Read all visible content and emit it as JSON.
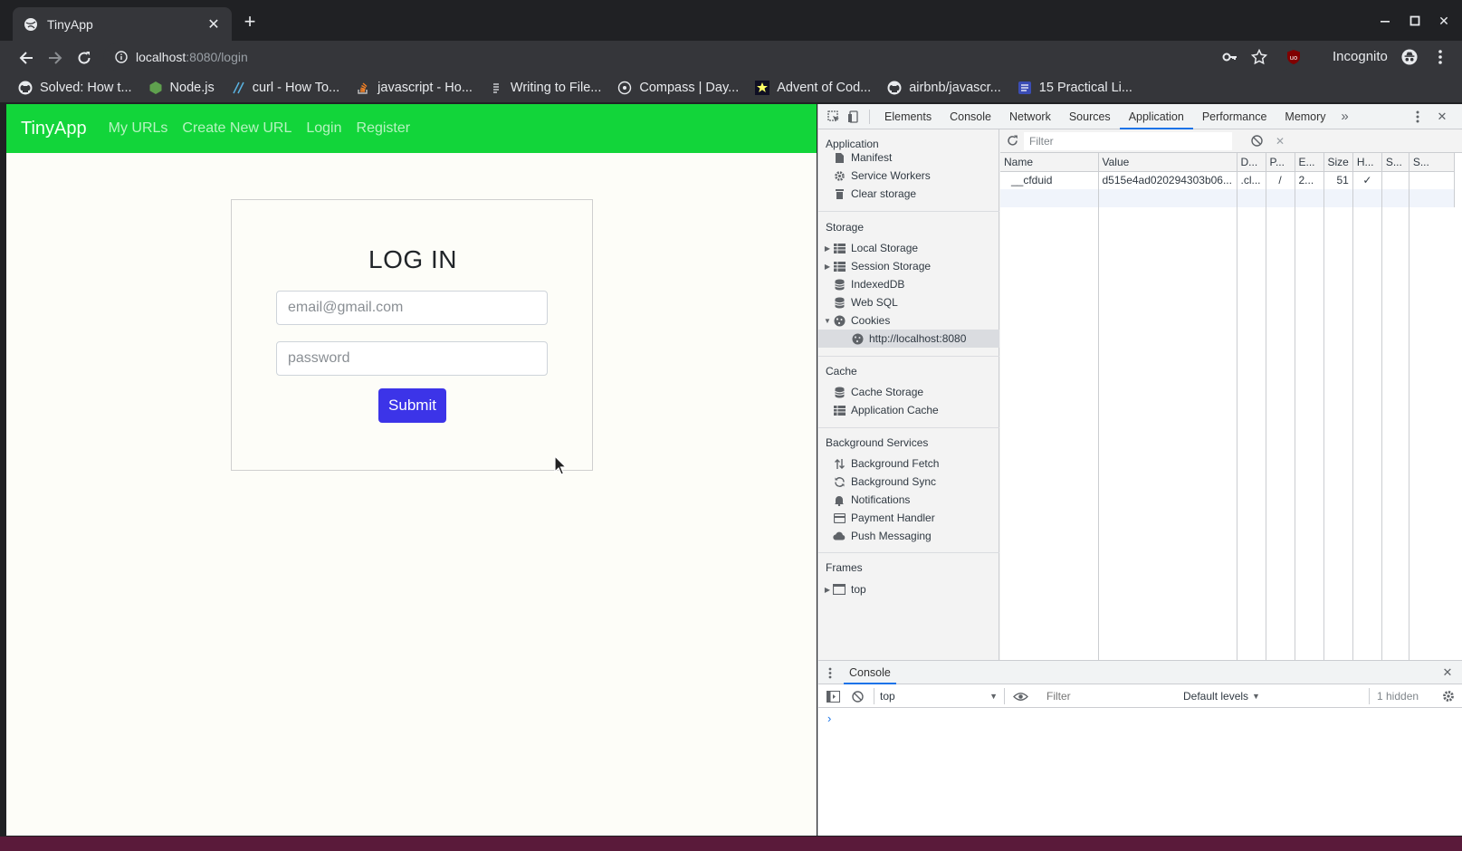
{
  "browser": {
    "tab_title": "TinyApp",
    "url_host": "localhost",
    "url_path": ":8080/login",
    "profile_label": "Incognito",
    "bookmarks": [
      {
        "label": "Solved: How t...",
        "icon": "github-icon"
      },
      {
        "label": "Node.js",
        "icon": "nodejs-icon"
      },
      {
        "label": "curl - How To...",
        "icon": "curl-icon"
      },
      {
        "label": "javascript - Ho...",
        "icon": "stackoverflow-icon"
      },
      {
        "label": "Writing to File...",
        "icon": "page-icon"
      },
      {
        "label": "Compass | Day...",
        "icon": "compass-icon"
      },
      {
        "label": "Advent of Cod...",
        "icon": "star-icon"
      },
      {
        "label": "airbnb/javascr...",
        "icon": "github-icon"
      },
      {
        "label": "15 Practical Li...",
        "icon": "doc-icon"
      }
    ]
  },
  "app": {
    "brand": "TinyApp",
    "nav": {
      "my_urls": "My URLs",
      "create_new_url": "Create New URL",
      "login": "Login",
      "register": "Register"
    },
    "login_form": {
      "heading": "LOG IN",
      "email_placeholder": "email@gmail.com",
      "password_placeholder": "password",
      "submit_label": "Submit"
    }
  },
  "devtools": {
    "tabs": [
      "Elements",
      "Console",
      "Network",
      "Sources",
      "Application",
      "Performance",
      "Memory"
    ],
    "active_tab": "Application",
    "sidebar": {
      "application_header": "Application",
      "application_items": [
        "Manifest",
        "Service Workers",
        "Clear storage"
      ],
      "storage_header": "Storage",
      "storage_items": [
        "Local Storage",
        "Session Storage",
        "IndexedDB",
        "Web SQL",
        "Cookies"
      ],
      "cookie_origin": "http://localhost:8080",
      "cache_header": "Cache",
      "cache_items": [
        "Cache Storage",
        "Application Cache"
      ],
      "bg_header": "Background Services",
      "bg_items": [
        "Background Fetch",
        "Background Sync",
        "Notifications",
        "Payment Handler",
        "Push Messaging"
      ],
      "frames_header": "Frames",
      "frames_items": [
        "top"
      ]
    },
    "cookies": {
      "filter_placeholder": "Filter",
      "columns": [
        "Name",
        "Value",
        "D...",
        "P...",
        "E...",
        "Size",
        "H...",
        "S...",
        "S..."
      ],
      "rows": [
        [
          "__cfduid",
          "d515e4ad020294303b06...",
          ".cl...",
          "/",
          "2...",
          "51",
          "✓",
          "",
          ""
        ]
      ]
    },
    "drawer": {
      "tab": "Console",
      "context": "top",
      "filter_placeholder": "Filter",
      "levels": "Default levels",
      "hidden_count": "1 hidden",
      "prompt": "›"
    }
  },
  "colors": {
    "app_nav": "#12d53a",
    "submit": "#3c34e8",
    "devtools_accent": "#1a73e8"
  }
}
